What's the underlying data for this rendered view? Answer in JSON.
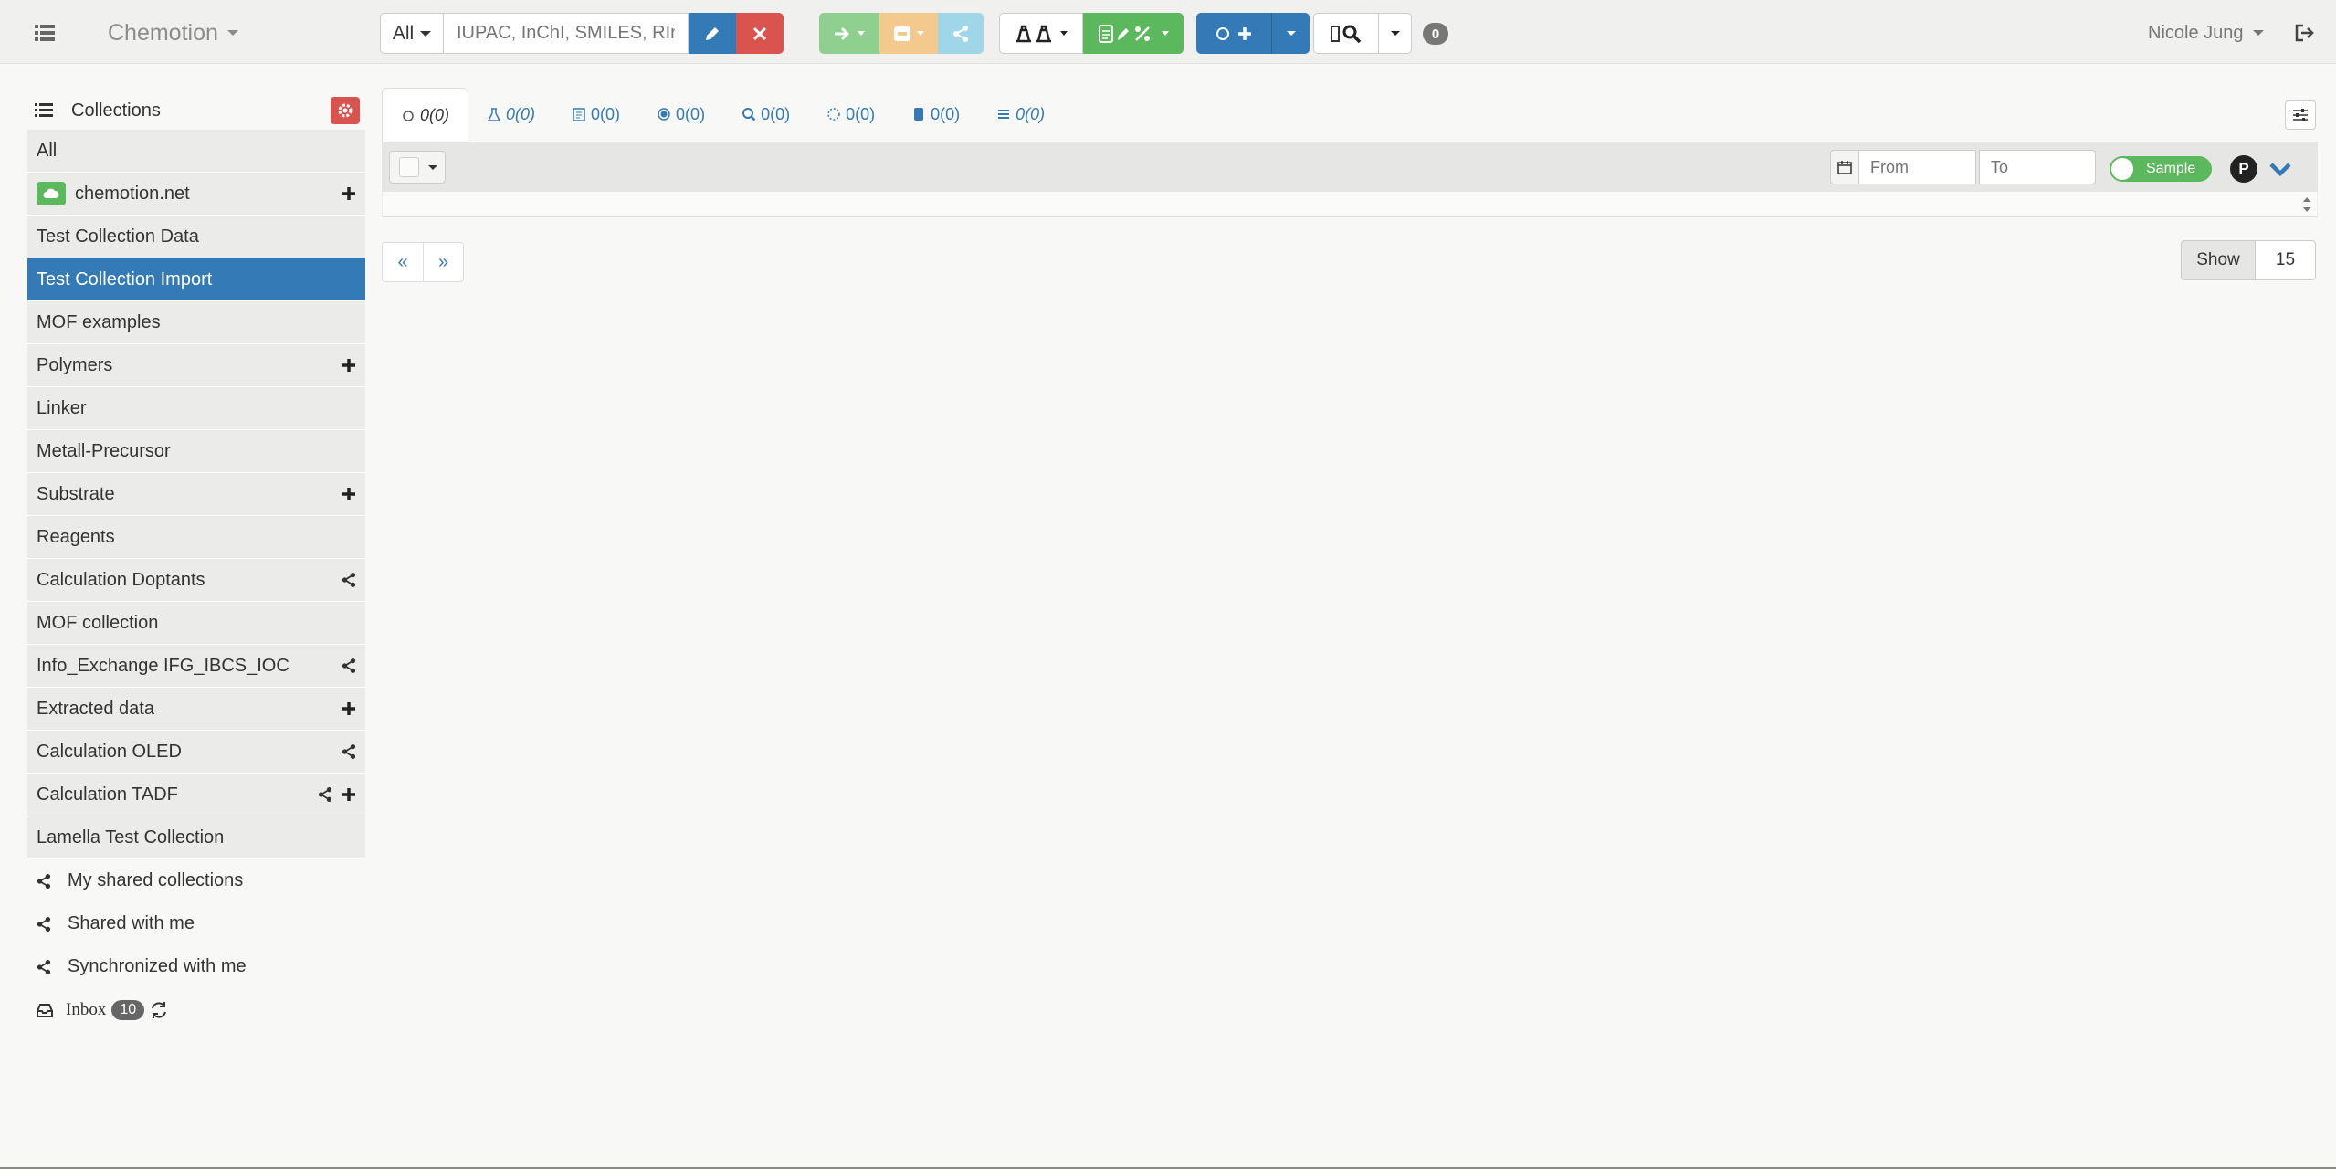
{
  "navbar": {
    "brand": "Chemotion",
    "search": {
      "scope": "All",
      "placeholder": "IUPAC, InChI, SMILES, RInChI"
    },
    "notification_count": "0",
    "user_name": "Nicole Jung"
  },
  "sidebar": {
    "header": "Collections",
    "collections": [
      {
        "label": "All",
        "icons": []
      },
      {
        "label": "chemotion.net",
        "icons": [
          "plus"
        ],
        "cloud": true
      },
      {
        "label": "Test Collection Data",
        "icons": []
      },
      {
        "label": "Test Collection Import",
        "icons": [],
        "active": true
      },
      {
        "label": "MOF examples",
        "icons": []
      },
      {
        "label": "Polymers",
        "icons": [
          "plus"
        ]
      },
      {
        "label": "Linker",
        "icons": []
      },
      {
        "label": "Metall-Precursor",
        "icons": []
      },
      {
        "label": "Substrate",
        "icons": [
          "plus"
        ]
      },
      {
        "label": "Reagents",
        "icons": []
      },
      {
        "label": "Calculation Doptants",
        "icons": [
          "share"
        ]
      },
      {
        "label": "MOF collection",
        "icons": []
      },
      {
        "label": "Info_Exchange IFG_IBCS_IOC",
        "icons": [
          "share"
        ]
      },
      {
        "label": "Extracted data",
        "icons": [
          "plus"
        ]
      },
      {
        "label": "Calculation OLED",
        "icons": [
          "share"
        ]
      },
      {
        "label": "Calculation TADF",
        "icons": [
          "share",
          "plus"
        ]
      },
      {
        "label": "Lamella Test Collection",
        "icons": []
      }
    ],
    "shared": [
      {
        "label": "My shared collections"
      },
      {
        "label": "Shared with me"
      },
      {
        "label": "Synchronized with me"
      }
    ],
    "inbox": {
      "label": "Inbox",
      "count": "10"
    }
  },
  "tabs": [
    {
      "icon": "sample-icon",
      "label": "0(0)",
      "active": true
    },
    {
      "icon": "reaction-icon",
      "label": "0(0)"
    },
    {
      "icon": "wellplate-icon",
      "label": "0(0)",
      "plain": true
    },
    {
      "icon": "screen-icon",
      "label": "0(0)",
      "plain": true
    },
    {
      "icon": "research-plan-icon",
      "label": "0(0)",
      "plain": true
    },
    {
      "icon": "cell-line-icon",
      "label": "0(0)",
      "plain": true
    },
    {
      "icon": "device-icon",
      "label": "0(0)",
      "plain": true
    },
    {
      "icon": "vessel-icon",
      "label": "0(0)"
    }
  ],
  "filters": {
    "from_placeholder": "From",
    "to_placeholder": "To",
    "toggle_label": "Sample",
    "p_badge": "P"
  },
  "pagination": {
    "prev": "«",
    "next": "»"
  },
  "page_size": {
    "label": "Show",
    "value": "15"
  },
  "colors": {
    "primary": "#337ab7",
    "success": "#5cb85c",
    "danger": "#d9534f",
    "warning": "#f0ad4e",
    "info": "#5bc0de"
  }
}
